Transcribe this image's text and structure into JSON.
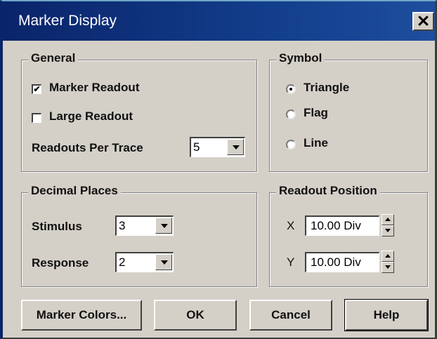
{
  "window": {
    "title": "Marker Display",
    "close_glyph": "✕"
  },
  "general": {
    "legend": "General",
    "marker_readout": {
      "label": "Marker Readout",
      "checked": true,
      "check_glyph": "✔"
    },
    "large_readout": {
      "label": "Large Readout",
      "checked": false
    },
    "readouts_per_trace": {
      "label": "Readouts Per Trace",
      "value": "5"
    }
  },
  "symbol": {
    "legend": "Symbol",
    "options": [
      {
        "label": "Triangle",
        "selected": true
      },
      {
        "label": "Flag",
        "selected": false
      },
      {
        "label": "Line",
        "selected": false
      }
    ]
  },
  "decimal_places": {
    "legend": "Decimal Places",
    "stimulus": {
      "label": "Stimulus",
      "value": "3"
    },
    "response": {
      "label": "Response",
      "value": "2"
    }
  },
  "readout_position": {
    "legend": "Readout Position",
    "x": {
      "label": "X",
      "value": "10.00 Div"
    },
    "y": {
      "label": "Y",
      "value": "10.00 Div"
    }
  },
  "buttons": {
    "marker_colors": "Marker Colors...",
    "ok": "OK",
    "cancel": "Cancel",
    "help": "Help"
  }
}
